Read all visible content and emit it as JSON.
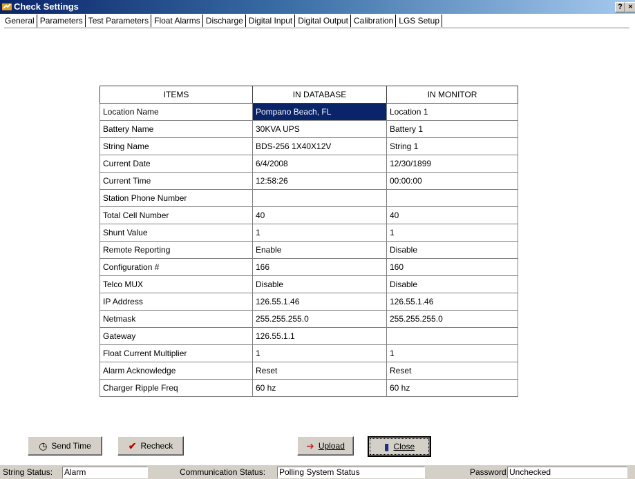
{
  "window": {
    "title": "Check Settings",
    "help_btn": "?",
    "close_btn": "×"
  },
  "tabs": [
    {
      "label": "General"
    },
    {
      "label": "Parameters"
    },
    {
      "label": "Test Parameters"
    },
    {
      "label": "Float Alarms"
    },
    {
      "label": "Discharge"
    },
    {
      "label": "Digital Input"
    },
    {
      "label": "Digital Output"
    },
    {
      "label": "Calibration"
    },
    {
      "label": "LGS Setup"
    }
  ],
  "table": {
    "headers": [
      "ITEMS",
      "IN DATABASE",
      "IN MONITOR"
    ],
    "rows": [
      {
        "item": "Location Name",
        "db": "Pompano Beach, FL",
        "mon": "Location 1"
      },
      {
        "item": "Battery Name",
        "db": "30KVA UPS",
        "mon": "Battery 1"
      },
      {
        "item": "String Name",
        "db": "BDS-256 1X40X12V",
        "mon": "String 1"
      },
      {
        "item": "Current Date",
        "db": "6/4/2008",
        "mon": "12/30/1899"
      },
      {
        "item": "Current Time",
        "db": "12:58:26",
        "mon": "00:00:00"
      },
      {
        "item": "Station Phone Number",
        "db": "",
        "mon": ""
      },
      {
        "item": "Total Cell Number",
        "db": "40",
        "mon": "40"
      },
      {
        "item": "Shunt Value",
        "db": "1",
        "mon": "1"
      },
      {
        "item": "Remote Reporting",
        "db": "Enable",
        "mon": "Disable"
      },
      {
        "item": "Configuration #",
        "db": "166",
        "mon": "160"
      },
      {
        "item": "Telco MUX",
        "db": "Disable",
        "mon": "Disable"
      },
      {
        "item": "IP Address",
        "db": "126.55.1.46",
        "mon": "126.55.1.46"
      },
      {
        "item": "Netmask",
        "db": "255.255.255.0",
        "mon": "255.255.255.0"
      },
      {
        "item": "Gateway",
        "db": "126.55.1.1",
        "mon": ""
      },
      {
        "item": "Float Current Multiplier",
        "db": "1",
        "mon": "1"
      },
      {
        "item": "Alarm Acknowledge",
        "db": "Reset",
        "mon": "Reset"
      },
      {
        "item": "Charger Ripple Freq",
        "db": "60 hz",
        "mon": "60 hz"
      }
    ]
  },
  "buttons": {
    "send_time": "Send Time",
    "recheck": "Recheck",
    "upload": "Upload",
    "close": "Close"
  },
  "status": {
    "string_label": "String Status:",
    "string_value": "Alarm",
    "comm_label": "Communication Status:",
    "comm_value": "Polling System Status",
    "password_label": "Password:",
    "password_value": "Unchecked"
  },
  "colors": {
    "selection": "#0a246a",
    "titlebar": "#0a246a",
    "face": "#d4d0c8"
  }
}
